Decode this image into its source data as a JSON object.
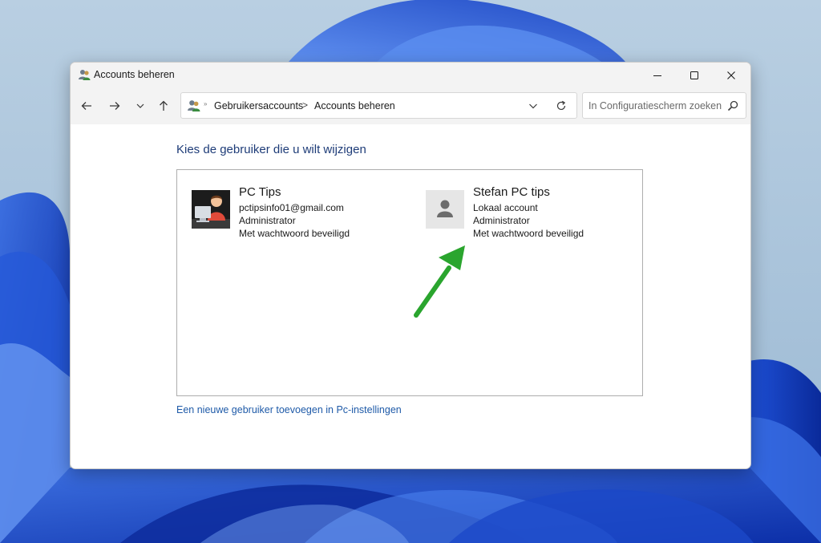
{
  "window": {
    "title": "Accounts beheren"
  },
  "navigation": {
    "breadcrumb": [
      "Gebruikersaccounts",
      "Accounts beheren"
    ],
    "breadcrumb_separator": ">",
    "root_separator": "»"
  },
  "search": {
    "placeholder": "In Configuratiescherm zoeken"
  },
  "main": {
    "title": "Kies de gebruiker die u wilt wijzigen",
    "users": [
      {
        "name": "PC Tips",
        "lines": [
          "pctipsinfo01@gmail.com",
          "Administrator",
          "Met wachtwoord beveiligd"
        ],
        "avatar": "illustrated-person-avatar"
      },
      {
        "name": "Stefan PC tips",
        "lines": [
          "Lokaal account",
          "Administrator",
          "Met wachtwoord beveiligd"
        ],
        "avatar": "default-user-avatar"
      }
    ],
    "add_user_link": "Een nieuwe gebruiker toevoegen in Pc-instellingen"
  },
  "colors": {
    "title_blue": "#1e3c78",
    "link_blue": "#1e5aa8",
    "annotation_arrow": "#2aa52e"
  },
  "icons": {
    "title": "user-accounts-icon",
    "back": "arrow-left-icon",
    "forward": "arrow-right-icon",
    "recent": "chevron-down-icon",
    "up": "arrow-up-icon",
    "refresh": "refresh-icon",
    "search": "search-icon"
  }
}
